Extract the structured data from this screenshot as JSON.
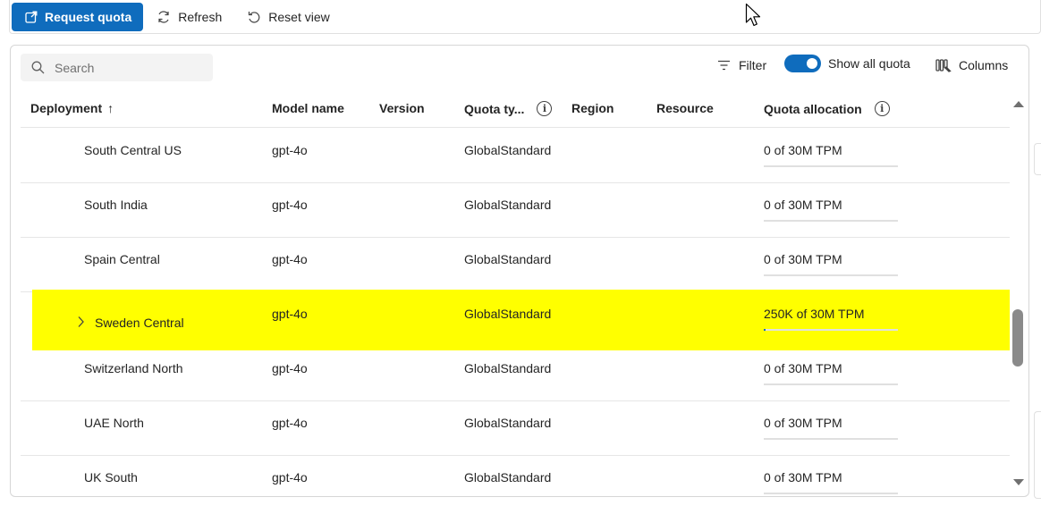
{
  "toolbar": {
    "request_quota": "Request quota",
    "refresh": "Refresh",
    "reset_view": "Reset view"
  },
  "controls": {
    "search_placeholder": "Search",
    "filter": "Filter",
    "show_all_quota": "Show all quota",
    "show_all_quota_on": true,
    "columns": "Columns"
  },
  "table": {
    "headers": {
      "deployment": "Deployment",
      "sort_arrow": "↑",
      "model_name": "Model name",
      "version": "Version",
      "quota_type": "Quota ty...",
      "region": "Region",
      "resource": "Resource",
      "quota_allocation": "Quota allocation"
    },
    "rows": [
      {
        "deployment": "South Central US",
        "model": "gpt-4o",
        "quota_type": "GlobalStandard",
        "allocation": "0 of 30M TPM",
        "usage_fraction": 0
      },
      {
        "deployment": "South India",
        "model": "gpt-4o",
        "quota_type": "GlobalStandard",
        "allocation": "0 of 30M TPM",
        "usage_fraction": 0
      },
      {
        "deployment": "Spain Central",
        "model": "gpt-4o",
        "quota_type": "GlobalStandard",
        "allocation": "0 of 30M TPM",
        "usage_fraction": 0
      },
      {
        "deployment": "Sweden Central",
        "model": "gpt-4o",
        "quota_type": "GlobalStandard",
        "allocation": "250K of 30M TPM",
        "usage_fraction": 0.0083,
        "expandable": true,
        "highlighted": true
      },
      {
        "deployment": "Switzerland North",
        "model": "gpt-4o",
        "quota_type": "GlobalStandard",
        "allocation": "0 of 30M TPM",
        "usage_fraction": 0
      },
      {
        "deployment": "UAE North",
        "model": "gpt-4o",
        "quota_type": "GlobalStandard",
        "allocation": "0 of 30M TPM",
        "usage_fraction": 0
      },
      {
        "deployment": "UK South",
        "model": "gpt-4o",
        "quota_type": "GlobalStandard",
        "allocation": "0 of 30M TPM",
        "usage_fraction": 0
      }
    ]
  },
  "colors": {
    "accent": "#0f6cbd",
    "highlight": "#ffff00"
  }
}
